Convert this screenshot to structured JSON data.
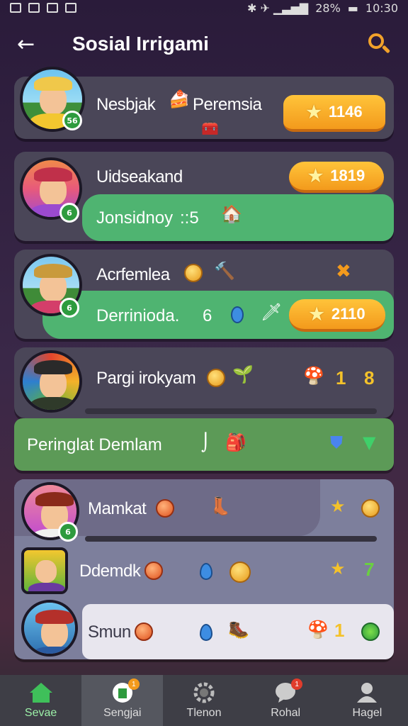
{
  "status_bar": {
    "battery": "28%",
    "time": "10:30"
  },
  "app_bar": {
    "title": "Sosial Irrigami"
  },
  "rows": [
    {
      "name": "Nesbjak",
      "name2": "Peremsia",
      "badge": "56",
      "score": "1146"
    },
    {
      "name": "Uidseakand",
      "badge": "6",
      "score": "1819",
      "strip_text": "Jonsidnoy",
      "strip_suffix": "::5"
    },
    {
      "name": "Acrfemlea",
      "badge": "6",
      "score": "2110",
      "strip_text": "Derrinioda.",
      "strip_num": "6"
    },
    {
      "name": "Pargi irokyam",
      "num1": "1",
      "num2": "8",
      "strip_text": "Peringlat Demlam"
    },
    {
      "name": "Mamkat",
      "badge": "6"
    },
    {
      "name": "Ddemdk",
      "num": "7"
    },
    {
      "name": "Smun",
      "num": "1"
    }
  ],
  "bottom_nav": [
    {
      "label": "Sevae"
    },
    {
      "label": "Sengjai",
      "badge": "1"
    },
    {
      "label": "Tlenon"
    },
    {
      "label": "Rohal",
      "badge": "1"
    },
    {
      "label": "Hagel"
    }
  ],
  "colors": {
    "accent": "#f39a1c",
    "green": "#4fb471",
    "card": "#4a4658"
  }
}
